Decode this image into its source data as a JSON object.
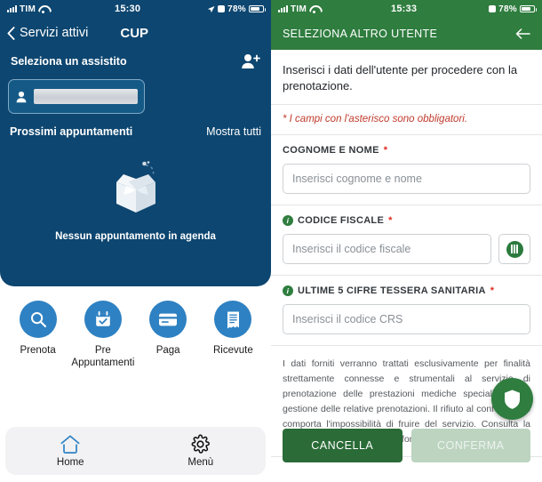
{
  "left": {
    "status": {
      "carrier": "TIM",
      "time": "15:30",
      "battery": "78%"
    },
    "nav": {
      "back_label": "Servizi attivi",
      "title": "CUP"
    },
    "assistito": {
      "section_title": "Seleziona un assistito",
      "add_icon": "person-plus-icon"
    },
    "appointments": {
      "title": "Prossimi appuntamenti",
      "link": "Mostra tutti",
      "empty_text": "Nessun appuntamento in agenda"
    },
    "actions": [
      {
        "label": "Prenota",
        "icon": "search-icon"
      },
      {
        "label": "Pre Appuntamenti",
        "icon": "calendar-check-icon"
      },
      {
        "label": "Paga",
        "icon": "credit-card-icon"
      },
      {
        "label": "Ricevute",
        "icon": "receipt-icon"
      }
    ],
    "tabs": [
      {
        "label": "Home",
        "icon": "home-icon"
      },
      {
        "label": "Menù",
        "icon": "gear-icon"
      }
    ],
    "colors": {
      "panel": "#0d4670",
      "accent": "#2e81c2"
    }
  },
  "right": {
    "status": {
      "carrier": "TIM",
      "time": "15:33",
      "battery": "78%"
    },
    "header": {
      "title": "SELEZIONA ALTRO UTENTE",
      "back_icon": "arrow-left-icon"
    },
    "intro": "Inserisci i dati dell'utente per procedere con la prenotazione.",
    "required_note": "* I campi con l'asterisco sono obbligatori.",
    "fields": [
      {
        "label": "COGNOME E NOME",
        "required": "*",
        "placeholder": "Inserisci cognome e nome",
        "value": "",
        "has_info_icon": false,
        "has_scan_button": false
      },
      {
        "label": "CODICE FISCALE",
        "required": "*",
        "placeholder": "Inserisci il codice fiscale",
        "value": "",
        "has_info_icon": true,
        "has_scan_button": true
      },
      {
        "label": "ULTIME 5 CIFRE TESSERA SANITARIA",
        "required": "*",
        "placeholder": "Inserisci il codice CRS",
        "value": "",
        "has_info_icon": true,
        "has_scan_button": false
      }
    ],
    "privacy": "I dati forniti verranno trattati esclusivamente per finalità strettamente connesse e strumentali al servizio di prenotazione delle prestazioni mediche specialistiche e gestione delle relative prenotazioni. Il rifiuto al conferimento comporta l'impossibilità di fruire del servizio. Consulta la l'informativa per maggiorni informazioni.",
    "fab": {
      "icon": "shield-icon"
    },
    "buttons": {
      "cancel": "CANCELLA",
      "confirm": "CONFERMA"
    },
    "colors": {
      "header": "#2f7d3f",
      "cancel": "#2a6b37",
      "confirm_disabled": "#bcd4c0",
      "required": "#c0392b"
    }
  }
}
